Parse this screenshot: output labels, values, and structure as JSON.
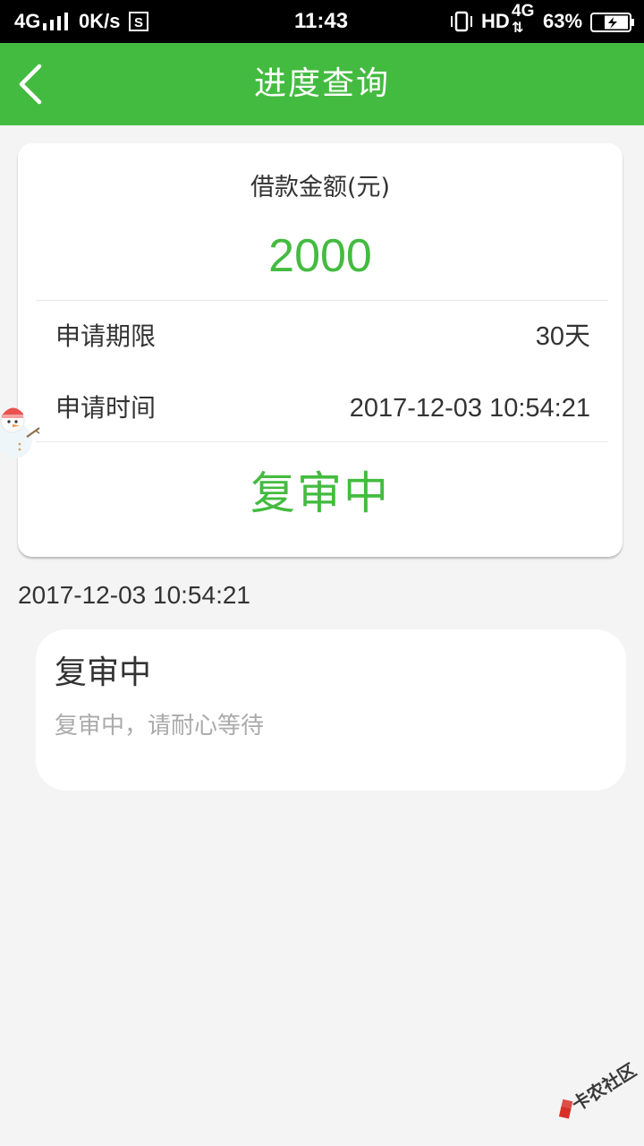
{
  "status_bar": {
    "network": "4G",
    "speed": "0K/s",
    "time": "11:43",
    "hd": "HD",
    "network_right": "4G",
    "battery": "63%"
  },
  "header": {
    "title": "进度查询",
    "back_icon": "chevron-left-icon",
    "background_color": "#43bb40"
  },
  "summary": {
    "amount_label": "借款金额(元)",
    "amount_value": "2000",
    "rows": [
      {
        "label": "申请期限",
        "value": "30天"
      },
      {
        "label": "申请时间",
        "value": "2017-12-03 10:54:21"
      }
    ],
    "status": "复审中",
    "accent_color": "#43bb40"
  },
  "timeline": [
    {
      "date": "2017-12-03 10:54:21",
      "title": "复审中",
      "description": "复审中，请耐心等待"
    }
  ],
  "watermark": {
    "text": "卡农社区"
  }
}
